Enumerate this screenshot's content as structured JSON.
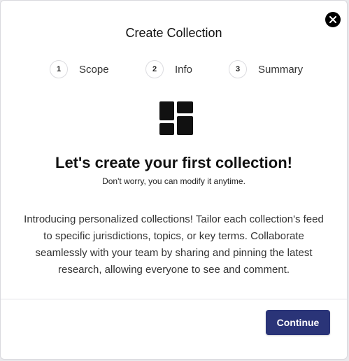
{
  "modal": {
    "title": "Create Collection",
    "close_icon": "close-icon"
  },
  "steps": [
    {
      "number": "1",
      "label": "Scope"
    },
    {
      "number": "2",
      "label": "Info"
    },
    {
      "number": "3",
      "label": "Summary"
    }
  ],
  "hero": {
    "icon": "dashboard-grid-icon",
    "heading": "Let's create your first collection!",
    "subheading": "Don't worry, you can modify it anytime.",
    "description": "Introducing personalized collections! Tailor each collection's feed to specific jurisdictions, topics, or key terms. Collaborate seamlessly with your team by sharing and pinning the latest research, allowing everyone to see and comment."
  },
  "footer": {
    "continue_label": "Continue"
  },
  "colors": {
    "primary_button": "#2a3478",
    "close_button": "#000000"
  }
}
